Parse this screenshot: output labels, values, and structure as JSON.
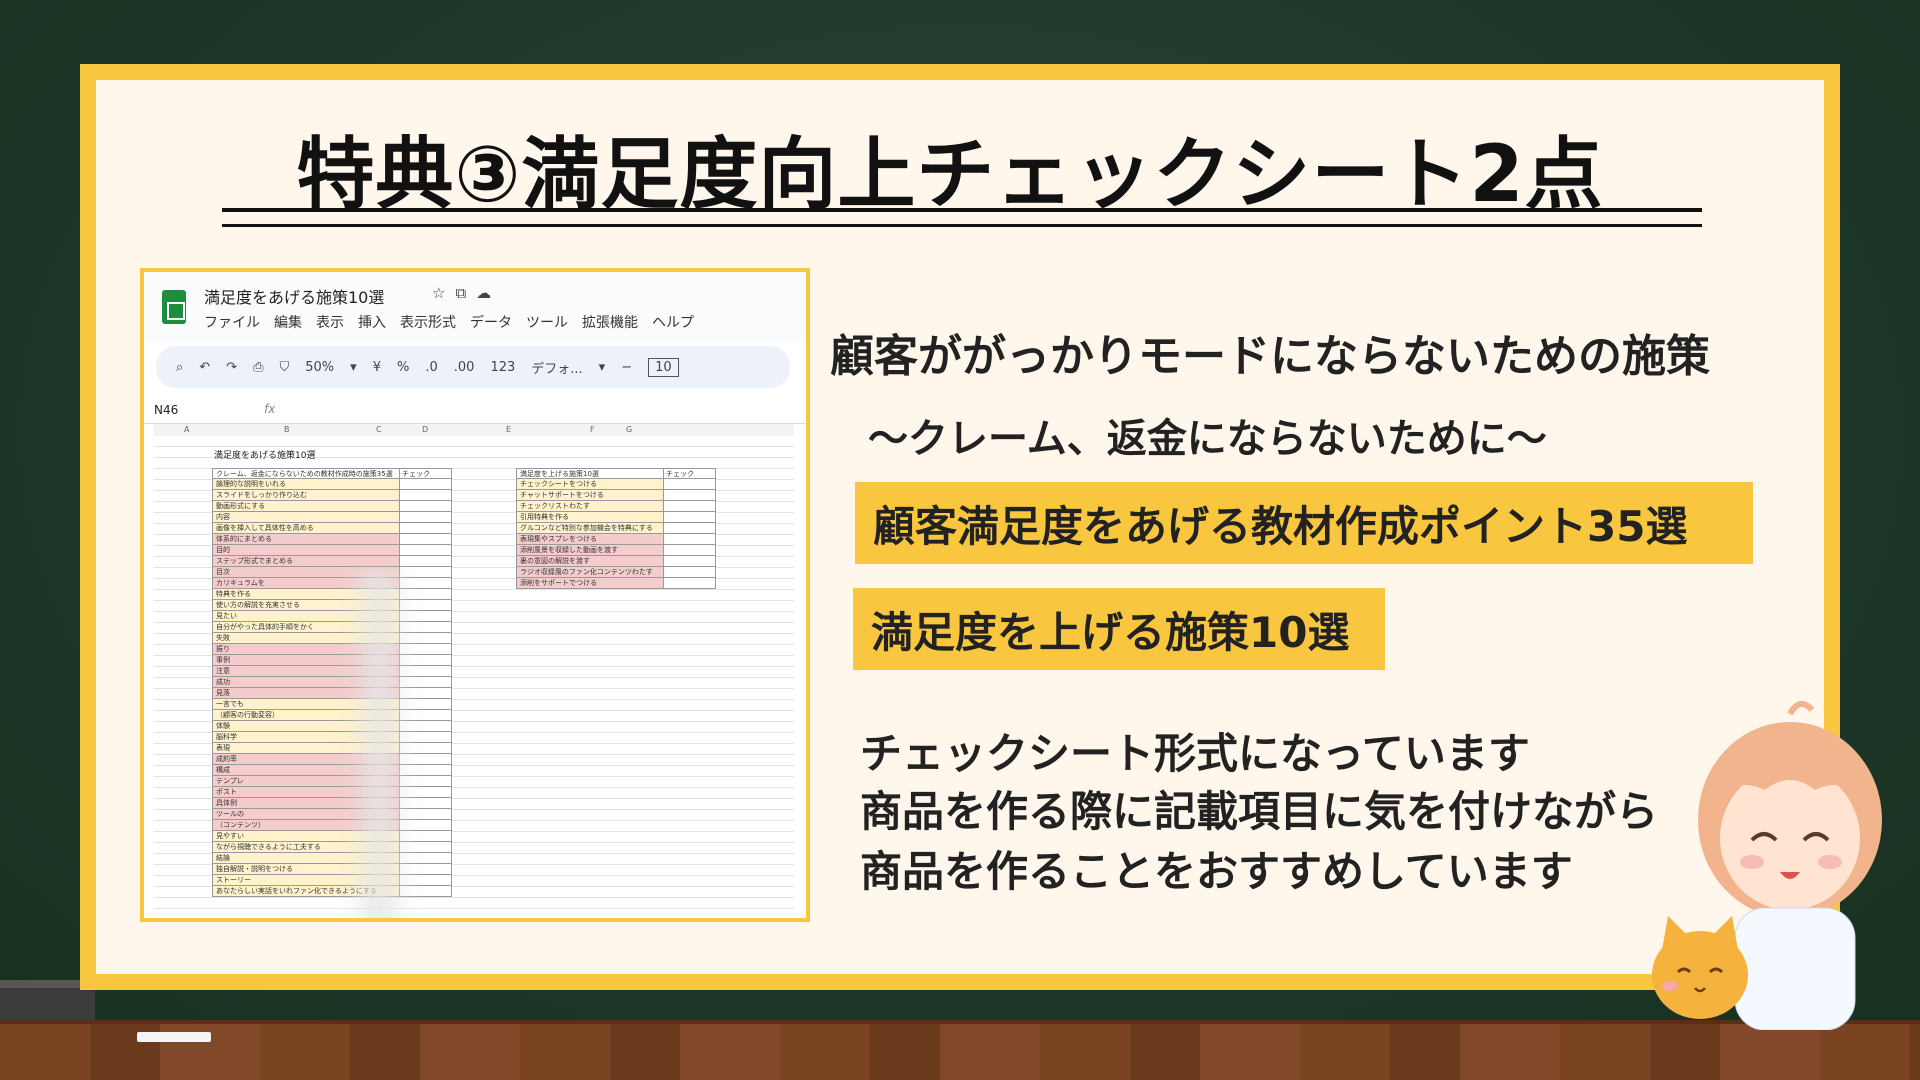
{
  "title": "特典③満足度向上チェックシート2点",
  "spreadsheet": {
    "doc_name": "満足度をあげる施策10選",
    "menu": [
      "ファイル",
      "編集",
      "表示",
      "挿入",
      "表示形式",
      "データ",
      "ツール",
      "拡張機能",
      "ヘルプ"
    ],
    "toolbar": {
      "zoom": "50%",
      "currency": "¥",
      "percent": "%",
      "dec_less": ".0",
      "dec_more": ".00",
      "format_123": "123",
      "font": "デフォ...",
      "minus": "−",
      "font_size": "10"
    },
    "name_box": "N46",
    "fx": "fx",
    "columns": [
      "A",
      "B",
      "C",
      "D",
      "E",
      "F",
      "G"
    ],
    "sheet_title": "満足度をあげる施策10選",
    "table_a": {
      "header": "クレーム、返金にならないための教材作成時の施策35選",
      "check_header": "チェック",
      "rows": [
        {
          "text": "論理的な説明をいれる",
          "color": "y"
        },
        {
          "text": "スライドをしっかり作り込む",
          "color": "y"
        },
        {
          "text": "動画形式にする",
          "color": "y"
        },
        {
          "text": "内容",
          "color": "y"
        },
        {
          "text": "画像を挿入して具体性を高める",
          "color": "y"
        },
        {
          "text": "体系的にまとめる",
          "color": "p"
        },
        {
          "text": "目的",
          "color": "p"
        },
        {
          "text": "ステップ形式でまとめる",
          "color": "p"
        },
        {
          "text": "目次",
          "color": "p"
        },
        {
          "text": "カリキュラムを",
          "color": "p"
        },
        {
          "text": "特典を作る",
          "color": "y"
        },
        {
          "text": "使い方の解説を充実させる",
          "color": "y"
        },
        {
          "text": "見たい",
          "color": "y"
        },
        {
          "text": "自分がやった具体的手順をかく",
          "color": "y"
        },
        {
          "text": "失敗",
          "color": "y"
        },
        {
          "text": "振り",
          "color": "p"
        },
        {
          "text": "事例",
          "color": "p"
        },
        {
          "text": "注意",
          "color": "p"
        },
        {
          "text": "成功",
          "color": "p"
        },
        {
          "text": "見落",
          "color": "p"
        },
        {
          "text": "一言でも",
          "color": "y"
        },
        {
          "text": "（顧客の行動変容）",
          "color": "y"
        },
        {
          "text": "体験",
          "color": "y"
        },
        {
          "text": "脳科学",
          "color": "y"
        },
        {
          "text": "表現",
          "color": "y"
        },
        {
          "text": "成約率",
          "color": "p"
        },
        {
          "text": "構成",
          "color": "p"
        },
        {
          "text": "テンプレ",
          "color": "p"
        },
        {
          "text": "ポスト",
          "color": "p"
        },
        {
          "text": "具体例",
          "color": "p"
        },
        {
          "text": "ツールの",
          "color": "p"
        },
        {
          "text": "（コンテンツ）",
          "color": "p"
        },
        {
          "text": "見やすい",
          "color": "y"
        },
        {
          "text": "ながら視聴できるように工夫する",
          "color": "y"
        },
        {
          "text": "結論",
          "color": "y"
        },
        {
          "text": "独自解説・説明をつける",
          "color": "y"
        },
        {
          "text": "ストーリー",
          "color": "y"
        },
        {
          "text": "あなたらしい実話をいれファン化できるようにする",
          "color": "y"
        }
      ]
    },
    "table_b": {
      "header": "満足度を上げる施策10選",
      "check_header": "チェック",
      "rows": [
        {
          "text": "チェックシートをつける",
          "color": "y"
        },
        {
          "text": "チャットサポートをつける",
          "color": "y"
        },
        {
          "text": "チェックリストわたす",
          "color": "y"
        },
        {
          "text": "引用特典を作る",
          "color": "y"
        },
        {
          "text": "グルコンなど特別な参加機会を特典にする",
          "color": "y"
        },
        {
          "text": "表現集やスプレをつける",
          "color": "p"
        },
        {
          "text": "添削風景を収録した動画を渡す",
          "color": "p"
        },
        {
          "text": "裏の意図の解説を渡す",
          "color": "p"
        },
        {
          "text": "ラジオ収録風のファン化コンテンツわたす",
          "color": "p"
        },
        {
          "text": "添削をサポートでつける",
          "color": "p"
        }
      ]
    }
  },
  "right": {
    "heading": "顧客ががっかりモードにならないための施策",
    "subheading": "〜クレーム、返金にならないために〜",
    "highlight1": "顧客満足度をあげる教材作成ポイント35選",
    "highlight2": "満足度を上げる施策10選",
    "body": [
      "チェックシート形式になっています",
      "商品を作る際に記載項目に気を付けながら",
      "商品を作ることをおすすめしています"
    ]
  },
  "colors": {
    "accent": "#f8c63f",
    "card": "#fff6ec",
    "board": "#1e3729",
    "cell_yellow": "#fff2cc",
    "cell_pink": "#f4cccc"
  }
}
